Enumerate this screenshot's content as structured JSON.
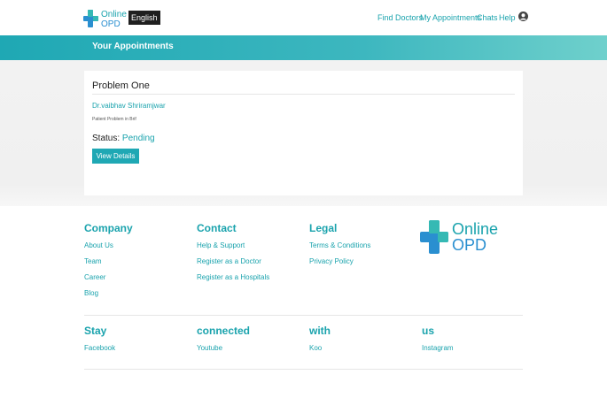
{
  "header": {
    "logo_line1": "Online",
    "logo_line2": "OPD",
    "language": "English",
    "nav": {
      "find_doctors": "Find Doctors",
      "my_appointments": "My Appointments",
      "chats": "Chats",
      "help": "Help"
    }
  },
  "banner": {
    "title": "Your Appointments"
  },
  "appointment": {
    "title": "Problem One",
    "doctor": "Dr.vaibhav Shriramjwar",
    "problem_brief": "Patient Problem in Brif",
    "status_label": "Status:",
    "status_value": "Pending",
    "view_details": "View Details"
  },
  "footer": {
    "company": {
      "heading": "Company",
      "links": [
        "About Us",
        "Team",
        "Career",
        "Blog"
      ]
    },
    "contact": {
      "heading": "Contact",
      "links": [
        "Help & Support",
        "Register as a Doctor",
        "Register as a Hospitals"
      ]
    },
    "legal": {
      "heading": "Legal",
      "links": [
        "Terms & Conditions",
        "Privacy Policy"
      ]
    },
    "logo_line1": "Online",
    "logo_line2": "OPD",
    "social_headings": [
      "Stay",
      "connected",
      "with",
      "us"
    ],
    "social_links": [
      "Facebook",
      "Youtube",
      "Koo",
      "Instagram"
    ]
  },
  "colors": {
    "accent": "#1aa3ad",
    "banner_start": "#1fa8b4",
    "banner_end": "#6fd0cc",
    "logo_blue": "#2a8fd0"
  }
}
